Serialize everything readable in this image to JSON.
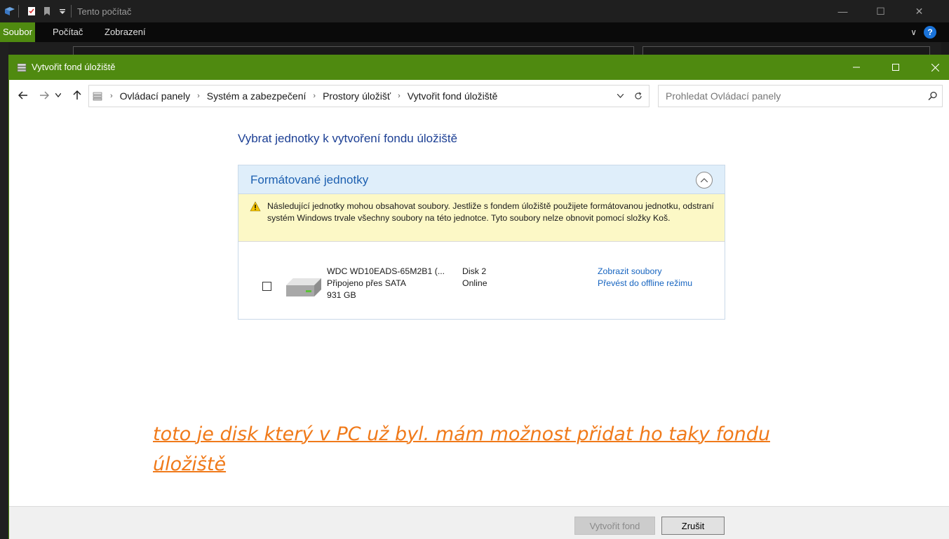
{
  "background_window": {
    "title": "Tento počítač",
    "ribbon_tabs": [
      "Soubor",
      "Počítač",
      "Zobrazení"
    ],
    "help_label": "?",
    "accent": "#4f8a10"
  },
  "dialog": {
    "title": "Vytvořit fond úložiště",
    "breadcrumbs": [
      "Ovládací panely",
      "Systém a zabezpečení",
      "Prostory úložišť",
      "Vytvořit fond úložiště"
    ],
    "search_placeholder": "Prohledat Ovládací panely",
    "heading": "Vybrat jednotky k vytvoření fondu úložiště",
    "section_title": "Formátované jednotky",
    "warning": "Následující jednotky mohou obsahovat soubory. Jestliže s fondem úložiště použijete formátovanou jednotku, odstraní systém Windows trvale všechny soubory na této jednotce. Tyto soubory nelze obnovit pomocí složky Koš.",
    "drive": {
      "name": "WDC WD10EADS-65M2B1 (...",
      "connection": "Připojeno přes SATA",
      "size": "931 GB",
      "disk": "Disk 2",
      "status": "Online",
      "checked": false,
      "link_view": "Zobrazit soubory",
      "link_offline": "Převést do offline režimu"
    },
    "annotation": "toto je disk který v PC už byl. mám možnost přidat ho taky fondu úložiště",
    "buttons": {
      "create": "Vytvořit fond",
      "cancel": "Zrušit"
    },
    "colors": {
      "titlebar": "#4f8a10",
      "heading": "#1c3f94",
      "link": "#1664c0",
      "annotation": "#f07a1a",
      "warning_bg": "#fcf8c6"
    }
  }
}
